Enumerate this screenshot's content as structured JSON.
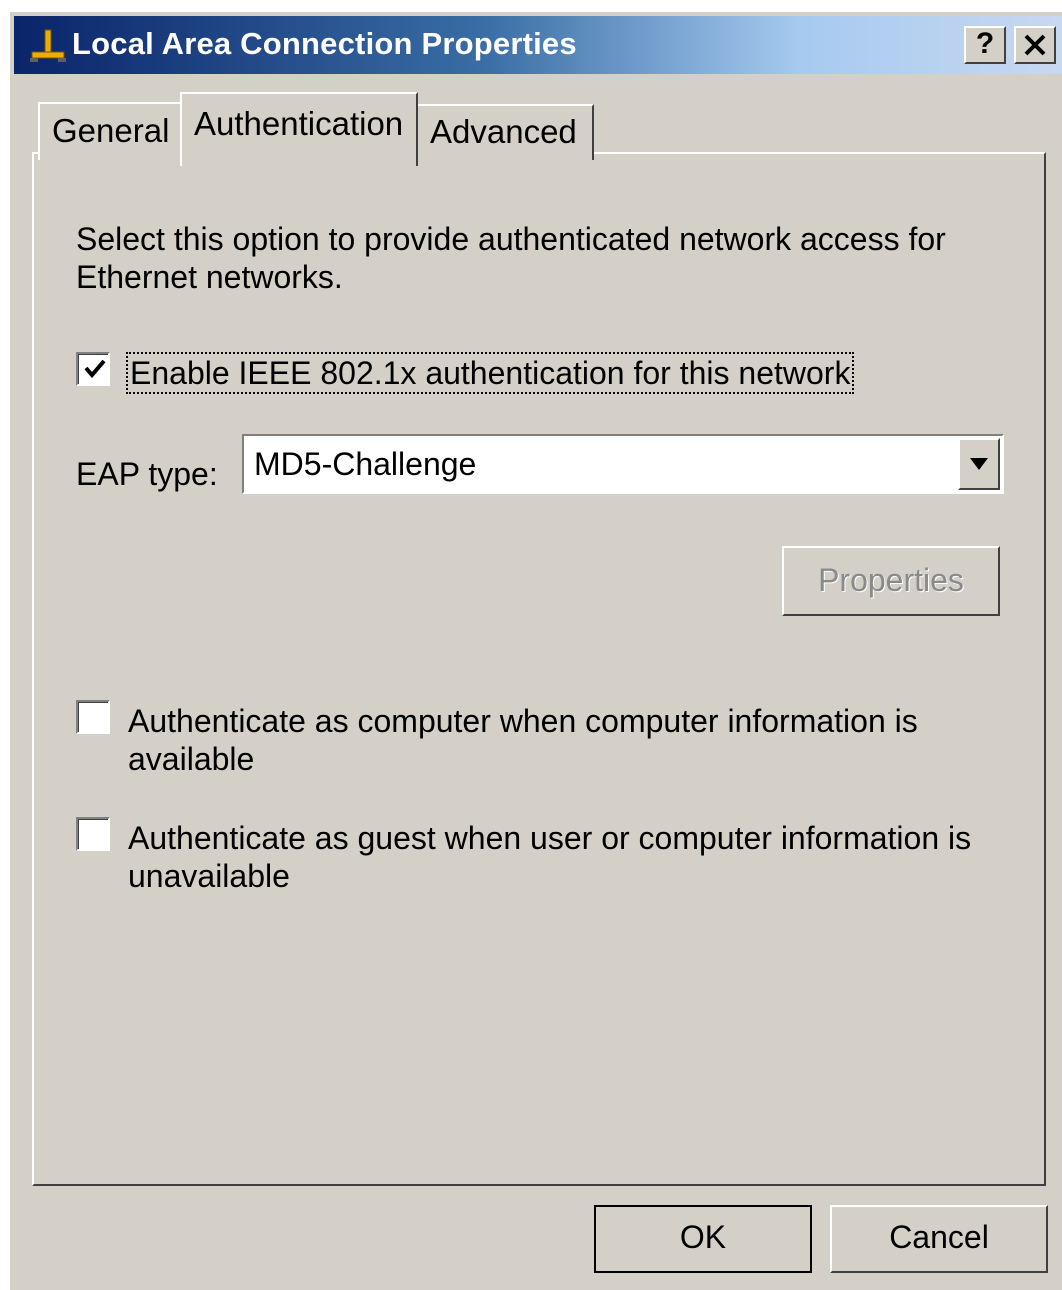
{
  "window": {
    "title": "Local Area Connection Properties",
    "title_icon": "network-connection-icon",
    "help_label": "?",
    "close_label": "✕"
  },
  "tabs": [
    {
      "label": "General",
      "active": false
    },
    {
      "label": "Authentication",
      "active": true
    },
    {
      "label": "Advanced",
      "active": false
    }
  ],
  "authentication": {
    "description": "Select this option to provide authenticated network access for Ethernet networks.",
    "enable_8021x": {
      "label": "Enable IEEE 802.1x authentication for this network",
      "checked": true
    },
    "eap_type_label": "EAP type:",
    "eap_type_value": "MD5-Challenge",
    "properties_button": "Properties",
    "properties_enabled": false,
    "auth_as_computer": {
      "label": "Authenticate as computer when computer information is available",
      "checked": false
    },
    "auth_as_guest": {
      "label": "Authenticate as guest when user or computer information is unavailable",
      "checked": false
    }
  },
  "buttons": {
    "ok": "OK",
    "cancel": "Cancel"
  },
  "colors": {
    "dialog_face": "#d4d0c8",
    "title_start": "#0a246a",
    "title_end": "#a6caf0",
    "disabled_text": "#8a8a8a"
  }
}
